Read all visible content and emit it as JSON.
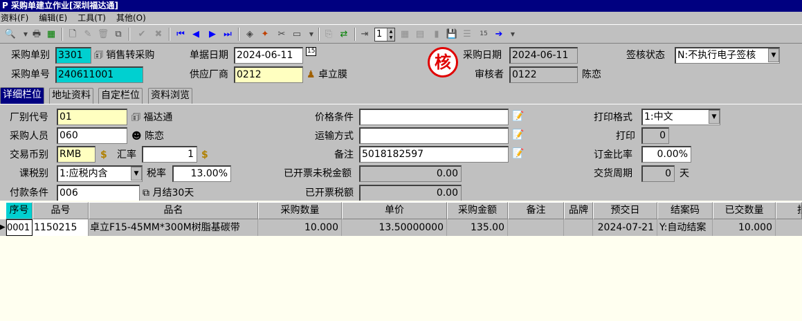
{
  "window": {
    "title": "采购单建立作业[深圳福达通]",
    "title_icon": "P"
  },
  "menu": [
    "资料(F)",
    "编辑(E)",
    "工具(T)",
    "其他(O)"
  ],
  "toolbar": {
    "page_value": "1"
  },
  "header": {
    "type_label": "采购单别",
    "type_value": "3301",
    "type_desc": "销售转采购",
    "no_label": "采购单号",
    "no_value": "240611001",
    "date_label": "单据日期",
    "date_value": "2024-06-11",
    "cal_icon": "15",
    "supplier_label": "供应厂商",
    "supplier_value": "0212",
    "supplier_name": "卓立膜",
    "stamp_char": "核",
    "pdate_label": "采购日期",
    "pdate_value": "2024-06-11",
    "reviewer_label": "审核者",
    "reviewer_value": "0122",
    "reviewer_name": "陈恋",
    "sign_label": "签核状态",
    "sign_value": "N:不执行电子签核"
  },
  "tabs": [
    "详细栏位",
    "地址资料",
    "自定栏位",
    "资料浏览"
  ],
  "detail": {
    "factory_label": "厂别代号",
    "factory_value": "01",
    "factory_name": "福达通",
    "buyer_label": "采购人员",
    "buyer_value": "060",
    "buyer_name": "陈恋",
    "currency_label": "交易币别",
    "currency_value": "RMB",
    "rate_label": "汇率",
    "rate_value": "1",
    "tax_label": "课税别",
    "tax_value": "1:应税内含",
    "taxrate_label": "税率",
    "taxrate_value": "13.00%",
    "pay_label": "付款条件",
    "pay_value": "006",
    "pay_desc": "月结30天",
    "price_label": "价格条件",
    "price_value": "",
    "ship_label": "运输方式",
    "ship_value": "",
    "note_label": "备注",
    "note_value": "5018182597",
    "untaxed_label": "已开票未税金额",
    "untaxed_value": "0.00",
    "taxamt_label": "已开票税额",
    "taxamt_value": "0.00",
    "printfmt_label": "打印格式",
    "printfmt_value": "1:中文",
    "print_label": "打印",
    "print_value": "0",
    "deposit_label": "订金比率",
    "deposit_value": "0.00%",
    "cycle_label": "交货周期",
    "cycle_value": "0",
    "cycle_unit": "天"
  },
  "grid": {
    "headers": [
      "序号",
      "品号",
      "品名",
      "采购数量",
      "单价",
      "采购金额",
      "备注",
      "品牌",
      "预交日",
      "结案码",
      "已交数量",
      "批"
    ],
    "rows": [
      [
        "0001",
        "1150215",
        "卓立F15-45MM*300M树脂基碳带",
        "10.000",
        "13.50000000",
        "135.00",
        "",
        "",
        "2024-07-21",
        "Y:自动结案",
        "10.000",
        ""
      ]
    ]
  }
}
